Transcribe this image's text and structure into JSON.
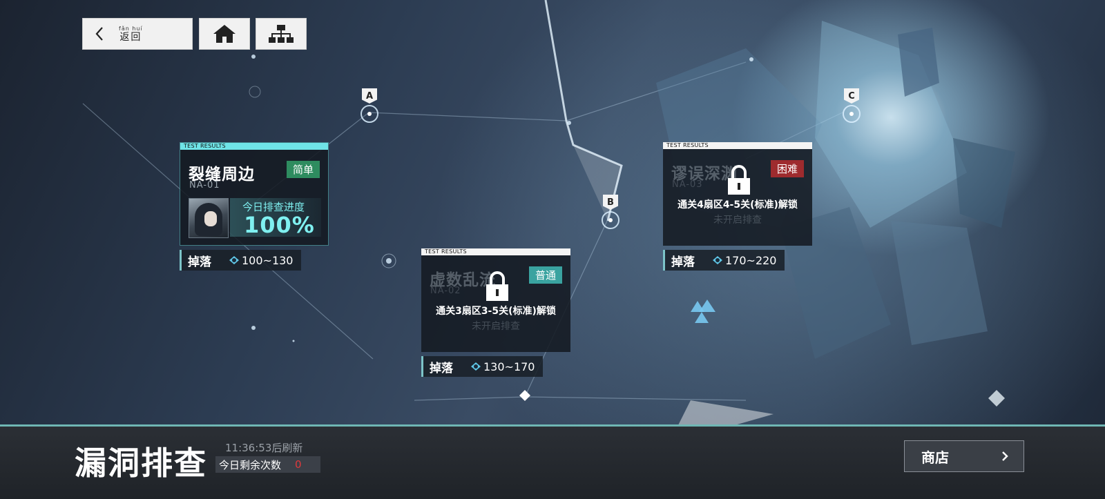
{
  "header": {
    "back": {
      "ruby": "fǎn  huí",
      "label": "返回"
    },
    "home_icon": "home-icon",
    "tree_icon": "sitemap-icon"
  },
  "markers": {
    "a": "A",
    "b": "B",
    "c": "C"
  },
  "stages": [
    {
      "status_header": "TEST RESULTS",
      "title": "裂缝周边",
      "code": "NA-01",
      "difficulty": "简单",
      "progress_label": "今日排查进度",
      "progress_value": "100%",
      "drop_label": "掉落",
      "drop_range": "100~130",
      "accent": "#6fe4e7"
    },
    {
      "status_header": "TEST RESULTS",
      "title": "虚数乱流",
      "code": "NA-02",
      "difficulty": "普通",
      "unlock_text": "通关3扇区3-5关(标准)解锁",
      "status_text": "未开启排查",
      "drop_label": "掉落",
      "drop_range": "130~170"
    },
    {
      "status_header": "TEST RESULTS",
      "title": "谬误深渊",
      "code": "NA-03",
      "difficulty": "困难",
      "unlock_text": "通关4扇区4-5关(标准)解锁",
      "status_text": "未开启排查",
      "drop_label": "掉落",
      "drop_range": "170~220"
    }
  ],
  "bottom": {
    "title": "漏洞排查",
    "refresh": "11:36:53后刷新",
    "remaining_label": "今日剩余次数",
    "remaining_count": "0",
    "shop_label": "商店"
  },
  "colors": {
    "accent_cyan": "#6fe4e7",
    "easy": "#2e8c5f",
    "normal": "#3aa3a0",
    "hard": "#9e2b2e",
    "remaining_count": "#e0393c"
  }
}
